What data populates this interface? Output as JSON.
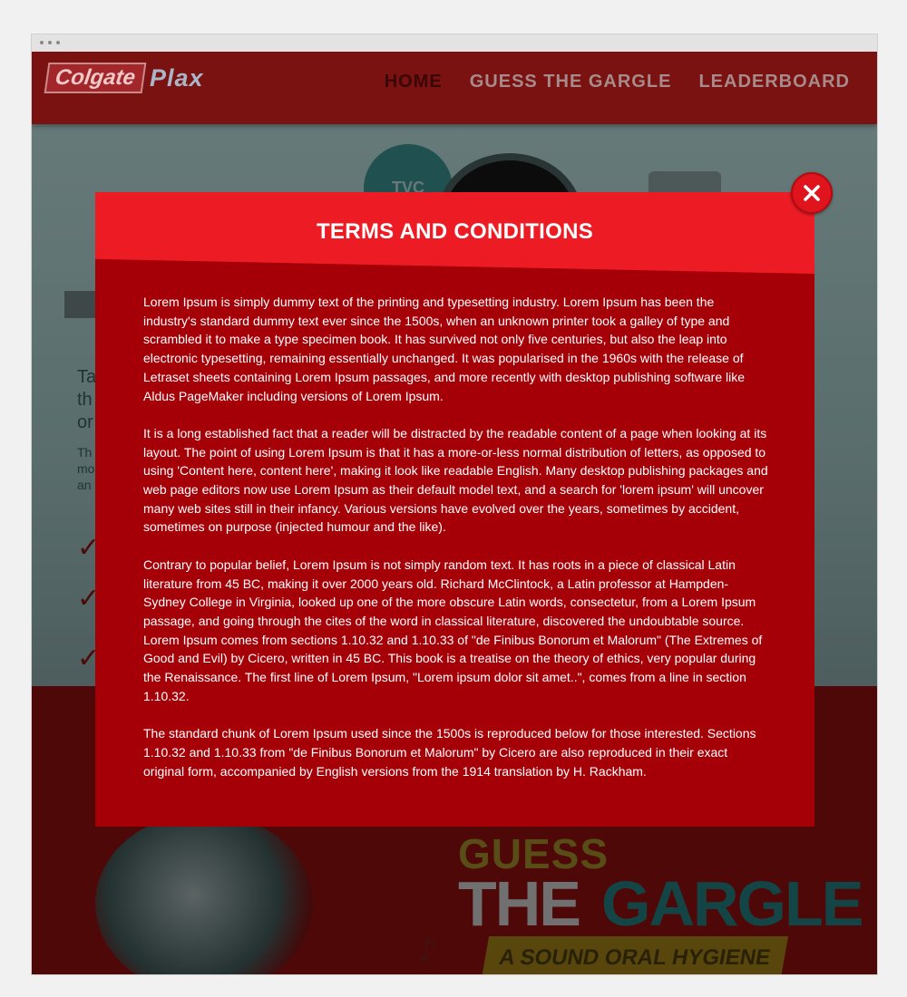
{
  "nav": {
    "logo_primary": "Colgate",
    "logo_secondary": "Plax",
    "links": [
      "HOME",
      "GUESS THE GARGLE",
      "LEADERBOARD"
    ]
  },
  "background": {
    "badge_text": "TVC",
    "side_heading_fragment": [
      "Ta",
      "th",
      "or"
    ],
    "side_body_fragment": [
      "Th",
      "mo",
      "an"
    ],
    "promo_title_top": "GUESS",
    "promo_title_the": "THE",
    "promo_title_gargle": "GARGLE",
    "promo_tagline": "A SOUND ORAL HYGIENE"
  },
  "modal": {
    "title": "TERMS AND CONDITIONS",
    "close_icon": "close-icon",
    "paragraphs": [
      "Lorem Ipsum is simply dummy text of the printing and typesetting industry. Lorem Ipsum has been the industry's standard dummy text ever since the 1500s, when an unknown printer took a galley of type and scrambled it to make a type specimen book. It has survived not only five centuries, but also the leap into electronic typesetting, remaining essentially unchanged. It was popularised in the 1960s with the release of Letraset sheets containing Lorem Ipsum passages, and more recently with desktop publishing software like Aldus PageMaker including versions of Lorem Ipsum.",
      "It is a long established fact that a reader will be distracted by the readable content of a page when looking at its layout. The point of using Lorem Ipsum is that it has a more-or-less normal distribution of letters, as opposed to using 'Content here, content here', making it look like readable English. Many desktop publishing packages and web page editors now use Lorem Ipsum as their default model text, and a search for 'lorem ipsum' will uncover many web sites still in their infancy. Various versions have evolved over the years, sometimes by accident, sometimes on purpose (injected humour and the like).",
      "Contrary to popular belief, Lorem Ipsum is not simply random text. It has roots in a piece of classical Latin literature from 45 BC, making it over 2000 years old. Richard McClintock, a Latin professor at Hampden-Sydney College in Virginia, looked up one of the more obscure Latin words, consectetur, from a Lorem Ipsum passage, and going through the cites of the word in classical literature, discovered the undoubtable source. Lorem Ipsum comes from sections 1.10.32 and 1.10.33 of \"de Finibus Bonorum et Malorum\" (The Extremes of Good and Evil) by Cicero, written in 45 BC. This book is a treatise on the theory of ethics, very popular during the Renaissance. The first line of Lorem Ipsum, \"Lorem ipsum dolor sit amet..\", comes from a line in section 1.10.32.",
      "The standard chunk of Lorem Ipsum used since the 1500s is reproduced below for those interested. Sections 1.10.32 and 1.10.33 from \"de Finibus Bonorum et Malorum\" by Cicero are also reproduced in their exact original form, accompanied by English versions from the 1914 translation by H. Rackham."
    ]
  },
  "colors": {
    "modal_header": "#ed1c24",
    "modal_body": "#a50008",
    "nav_bar": "#7a1212"
  }
}
